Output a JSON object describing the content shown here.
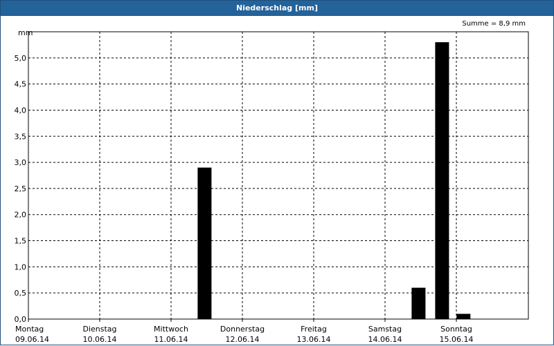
{
  "window": {
    "title": "Niederschlag [mm]"
  },
  "summary": "Summe = 8,9 mm",
  "chart_data": {
    "type": "bar",
    "title": "Niederschlag [mm]",
    "ylabel": "mm",
    "ylim": [
      0,
      5.5
    ],
    "y_ticks": [
      "0,0",
      "0,5",
      "1,0",
      "1,5",
      "2,0",
      "2,5",
      "3,0",
      "3,5",
      "4,0",
      "4,5",
      "5,0"
    ],
    "x_ticks": [
      {
        "day": "Montag",
        "date": "09.06.14"
      },
      {
        "day": "Dienstag",
        "date": "10.06.14"
      },
      {
        "day": "Mittwoch",
        "date": "11.06.14"
      },
      {
        "day": "Donnerstag",
        "date": "12.06.14"
      },
      {
        "day": "Freitag",
        "date": "13.06.14"
      },
      {
        "day": "Samstag",
        "date": "14.06.14"
      },
      {
        "day": "Sonntag",
        "date": "15.06.14"
      }
    ],
    "x_domain_days": 7,
    "bars": [
      {
        "day_offset": 2.47,
        "value": 2.9
      },
      {
        "day_offset": 5.47,
        "value": 0.6
      },
      {
        "day_offset": 5.8,
        "value": 5.3
      },
      {
        "day_offset": 6.1,
        "value": 0.1
      }
    ],
    "bar_color": "#000000",
    "grid": true
  }
}
